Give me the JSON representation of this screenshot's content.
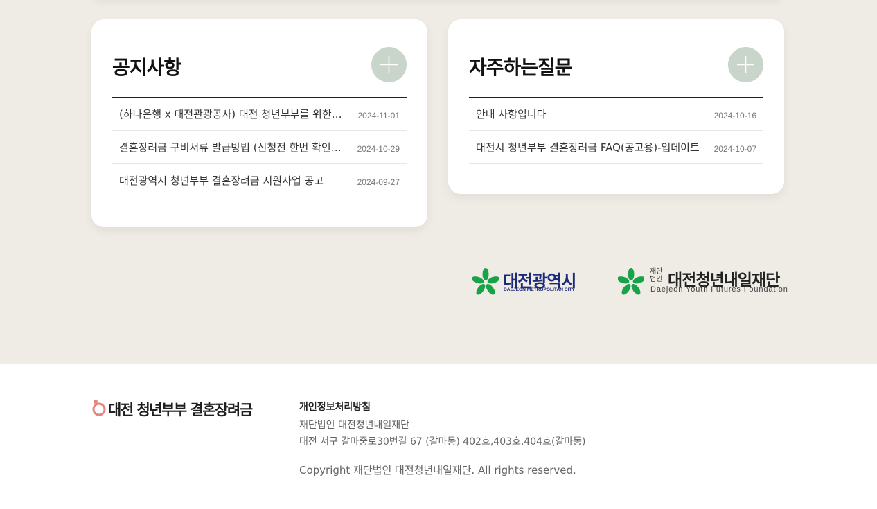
{
  "notice": {
    "title": "공지사항",
    "more_icon": "plus-icon",
    "items": [
      {
        "title": "(하나은행 x 대전관광공사) 대전 청년부부를 위한 혜택 안내",
        "date": "2024-11-01"
      },
      {
        "title": "결혼장려금 구비서류 발급방법 (신청전 한번 확인해주세요)",
        "date": "2024-10-29"
      },
      {
        "title": "대전광역시 청년부부 결혼장려금 지원사업 공고",
        "date": "2024-09-27"
      }
    ]
  },
  "faq": {
    "title": "자주하는질문",
    "more_icon": "plus-icon",
    "items": [
      {
        "title": "안내 사항입니다",
        "date": "2024-10-16"
      },
      {
        "title": "대전시 청년부부 결혼장려금 FAQ(공고용)-업데이트",
        "date": "2024-10-07"
      }
    ]
  },
  "partners": {
    "city": {
      "name": "대전광역시",
      "sub": "DAEJEON METROPOLITAN CITY",
      "color": "#1b2a7a"
    },
    "foundation": {
      "prefix": "재단 법인",
      "name": "대전청년내일재단",
      "sub": "Daejeon Youth Futures Foundation"
    },
    "emblem_color": "#17a348"
  },
  "footer": {
    "logo_text": "대전 청년부부 결혼장려금",
    "ring_icon": "ring-icon",
    "ring_color": "#e7837f",
    "privacy_label": "개인정보처리방침",
    "org": "재단법인 대전청년내일재단",
    "address": "대전 서구 갈마중로30번길 67 (갈마동) 402호,403호,404호(갈마동)",
    "copyright": "Copyright 재단법인 대전청년내일재단. All rights reserved."
  },
  "colors": {
    "page_bg": "#efebe5",
    "plus_button": "#c9d4ca"
  }
}
